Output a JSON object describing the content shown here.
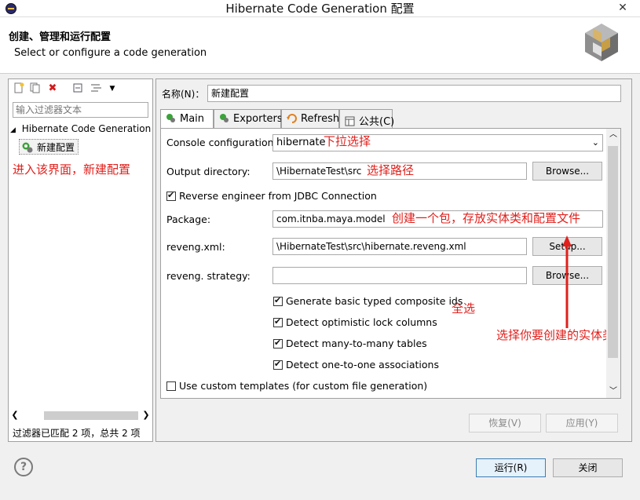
{
  "window": {
    "title": "Hibernate Code Generation 配置",
    "close_glyph": "✕"
  },
  "header": {
    "title": "创建、管理和运行配置",
    "subtitle": "Select or configure a code generation"
  },
  "left": {
    "filter_placeholder": "输入过滤器文本",
    "tree_parent": "Hibernate Code Generation",
    "tree_child": "新建配置",
    "annotation": "进入该界面，新建配置",
    "status": "过滤器已匹配 2 项，总共 2 项"
  },
  "right": {
    "name_label": "名称(N)：",
    "name_value": "新建配置",
    "tabs": [
      {
        "label": "Main"
      },
      {
        "label": "Exporters"
      },
      {
        "label": "Refresh"
      },
      {
        "label": "公共(C)"
      }
    ],
    "fields": {
      "console_label": "Console configuration:",
      "console_value": "hibernate",
      "console_annotation": "下拉选择",
      "output_label": "Output directory:",
      "output_value": "\\HibernateTest\\src",
      "output_annotation": "选择路径",
      "reverse_label": "Reverse engineer from JDBC Connection",
      "package_label": "Package:",
      "package_value": "com.itnba.maya.model",
      "package_annotation": "创建一个包，存放实体类和配置文件",
      "reveng_label": "reveng.xml:",
      "reveng_value": "\\HibernateTest\\src\\hibernate.reveng.xml",
      "strategy_label": "reveng. strategy:",
      "strategy_value": ""
    },
    "buttons": {
      "browse": "Browse...",
      "setup": "Setup...",
      "revert": "恢复(V)",
      "apply": "应用(Y)"
    },
    "checkboxes": [
      {
        "label": "Generate basic typed composite ids",
        "checked": true
      },
      {
        "label": "Detect optimistic lock columns",
        "checked": true
      },
      {
        "label": "Detect many-to-many tables",
        "checked": true
      },
      {
        "label": "Detect one-to-one associations",
        "checked": true
      }
    ],
    "custom_templates_label": "Use custom templates (for custom file generation)",
    "select_all_annotation": "全选",
    "entity_annotation": "选择你要创建的实体类"
  },
  "footer": {
    "help_glyph": "?",
    "run": "运行(R)",
    "close": "关闭"
  },
  "colors": {
    "annotation": "#e0201c",
    "accent": "#3c7fb1"
  }
}
